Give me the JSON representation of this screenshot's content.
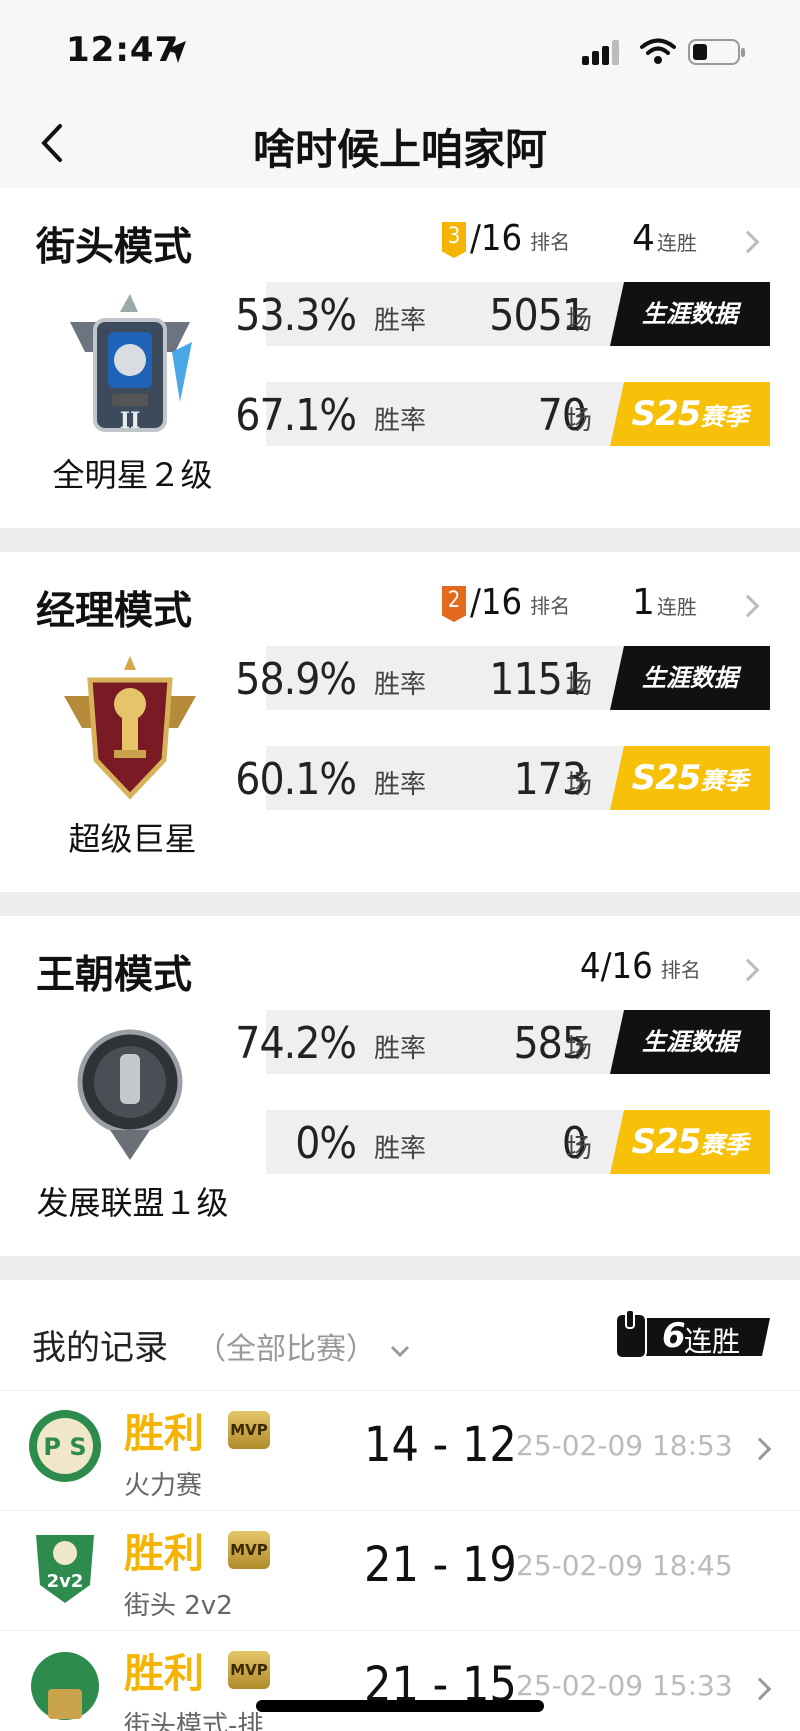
{
  "status": {
    "time": "12:47"
  },
  "nav": {
    "title": "啥时候上咱家阿"
  },
  "modes": [
    {
      "title": "街头模式",
      "rank_badge": "3",
      "rank_badge_color": "#f4b400",
      "rank": "/16",
      "rank_label": "排名",
      "streak_num": "4",
      "streak_label": "连胜",
      "emblem_label": "全明星２级",
      "career": {
        "pct": "53.3%",
        "pct_label": "胜率",
        "games": "5051",
        "games_label": "场",
        "button": "生涯数据"
      },
      "season": {
        "pct": "67.1%",
        "pct_label": "胜率",
        "games": "70",
        "games_label": "场",
        "button_prefix": "S25",
        "button": "赛季"
      }
    },
    {
      "title": "经理模式",
      "rank_badge": "2",
      "rank_badge_color": "#e36a1c",
      "rank": "/16",
      "rank_label": "排名",
      "streak_num": "1",
      "streak_label": "连胜",
      "emblem_label": "超级巨星",
      "career": {
        "pct": "58.9%",
        "pct_label": "胜率",
        "games": "1151",
        "games_label": "场",
        "button": "生涯数据"
      },
      "season": {
        "pct": "60.1%",
        "pct_label": "胜率",
        "games": "173",
        "games_label": "场",
        "button_prefix": "S25",
        "button": "赛季"
      }
    },
    {
      "title": "王朝模式",
      "rank": "4/16",
      "rank_label": "排名",
      "emblem_label": "发展联盟１级",
      "career": {
        "pct": "74.2%",
        "pct_label": "胜率",
        "games": "585",
        "games_label": "场",
        "button": "生涯数据"
      },
      "season": {
        "pct": "0%",
        "pct_label": "胜率",
        "games": "0",
        "games_label": "场",
        "button_prefix": "S25",
        "button": "赛季"
      }
    }
  ],
  "records": {
    "title": "我的记录",
    "filter": "（全部比赛）",
    "streak_num": "6",
    "streak_label": "连胜",
    "items": [
      {
        "result": "胜利",
        "mvp": "MVP",
        "mode": "火力赛",
        "score": "14 - 12",
        "date": "25-02-09 18:53",
        "team_icon": "pcs"
      },
      {
        "result": "胜利",
        "mvp": "MVP",
        "mode": "街头 2v2",
        "score": "21 - 19",
        "date": "25-02-09 18:45",
        "team_icon": "2v2"
      },
      {
        "result": "胜利",
        "mvp": "MVP",
        "mode": "街头模式-排",
        "score": "21 - 15",
        "date": "25-02-09 15:33",
        "team_icon": "rank"
      }
    ]
  }
}
